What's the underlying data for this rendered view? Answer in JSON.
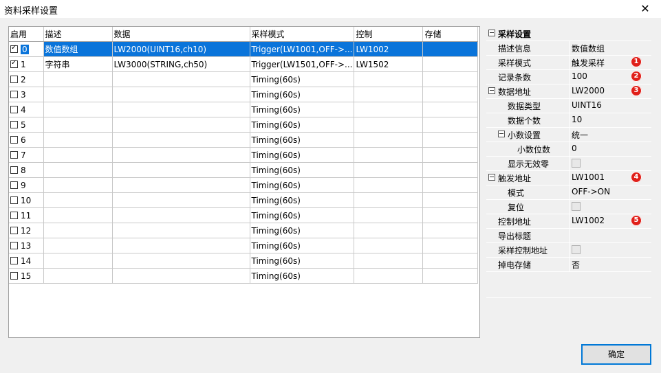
{
  "window": {
    "title": "资料采样设置",
    "close_glyph": "✕"
  },
  "table": {
    "headers": [
      "启用",
      "描述",
      "数据",
      "采样模式",
      "控制",
      "存储"
    ],
    "rows": [
      {
        "enabled": true,
        "index": "0",
        "desc": "数值数组",
        "data": "LW2000(UINT16,ch10)",
        "mode": "Trigger(LW1001,OFF->...",
        "ctrl": "LW1002",
        "store": ""
      },
      {
        "enabled": true,
        "index": "1",
        "desc": "字符串",
        "data": "LW3000(STRING,ch50)",
        "mode": "Trigger(LW1501,OFF->...",
        "ctrl": "LW1502",
        "store": ""
      },
      {
        "enabled": false,
        "index": "2",
        "desc": "",
        "data": "",
        "mode": "Timing(60s)",
        "ctrl": "",
        "store": ""
      },
      {
        "enabled": false,
        "index": "3",
        "desc": "",
        "data": "",
        "mode": "Timing(60s)",
        "ctrl": "",
        "store": ""
      },
      {
        "enabled": false,
        "index": "4",
        "desc": "",
        "data": "",
        "mode": "Timing(60s)",
        "ctrl": "",
        "store": ""
      },
      {
        "enabled": false,
        "index": "5",
        "desc": "",
        "data": "",
        "mode": "Timing(60s)",
        "ctrl": "",
        "store": ""
      },
      {
        "enabled": false,
        "index": "6",
        "desc": "",
        "data": "",
        "mode": "Timing(60s)",
        "ctrl": "",
        "store": ""
      },
      {
        "enabled": false,
        "index": "7",
        "desc": "",
        "data": "",
        "mode": "Timing(60s)",
        "ctrl": "",
        "store": ""
      },
      {
        "enabled": false,
        "index": "8",
        "desc": "",
        "data": "",
        "mode": "Timing(60s)",
        "ctrl": "",
        "store": ""
      },
      {
        "enabled": false,
        "index": "9",
        "desc": "",
        "data": "",
        "mode": "Timing(60s)",
        "ctrl": "",
        "store": ""
      },
      {
        "enabled": false,
        "index": "10",
        "desc": "",
        "data": "",
        "mode": "Timing(60s)",
        "ctrl": "",
        "store": ""
      },
      {
        "enabled": false,
        "index": "11",
        "desc": "",
        "data": "",
        "mode": "Timing(60s)",
        "ctrl": "",
        "store": ""
      },
      {
        "enabled": false,
        "index": "12",
        "desc": "",
        "data": "",
        "mode": "Timing(60s)",
        "ctrl": "",
        "store": ""
      },
      {
        "enabled": false,
        "index": "13",
        "desc": "",
        "data": "",
        "mode": "Timing(60s)",
        "ctrl": "",
        "store": ""
      },
      {
        "enabled": false,
        "index": "14",
        "desc": "",
        "data": "",
        "mode": "Timing(60s)",
        "ctrl": "",
        "store": ""
      },
      {
        "enabled": false,
        "index": "15",
        "desc": "",
        "data": "",
        "mode": "Timing(60s)",
        "ctrl": "",
        "store": ""
      }
    ]
  },
  "properties": {
    "section_title": "采样设置",
    "desc_info": {
      "label": "描述信息",
      "value": "数值数组"
    },
    "sample_mode": {
      "label": "采样模式",
      "value": "触发采样",
      "badge": "1"
    },
    "record_count": {
      "label": "记录条数",
      "value": "100",
      "badge": "2"
    },
    "data_address": {
      "label": "数据地址",
      "value": "LW2000",
      "badge": "3"
    },
    "data_type": {
      "label": "数据类型",
      "value": "UINT16"
    },
    "data_count": {
      "label": "数据个数",
      "value": "10"
    },
    "decimal_setting": {
      "label": "小数设置",
      "value": "统一"
    },
    "decimal_places": {
      "label": "小数位数",
      "value": "0"
    },
    "show_invalid_zero": {
      "label": "显示无效零",
      "checked": false
    },
    "trigger_address": {
      "label": "触发地址",
      "value": "LW1001",
      "badge": "4"
    },
    "trigger_mode": {
      "label": "模式",
      "value": "OFF->ON"
    },
    "reset": {
      "label": "复位",
      "checked": false
    },
    "control_address": {
      "label": "控制地址",
      "value": "LW1002",
      "badge": "5"
    },
    "export_title": {
      "label": "导出标题",
      "value": ""
    },
    "sample_ctrl_addr": {
      "label": "采样控制地址",
      "checked": false
    },
    "power_off_store": {
      "label": "掉电存储",
      "value": "否"
    }
  },
  "buttons": {
    "ok": "确定"
  },
  "colors": {
    "selection": "#0a74da",
    "badge": "#e0201a",
    "ok_border": "#0078d7"
  }
}
